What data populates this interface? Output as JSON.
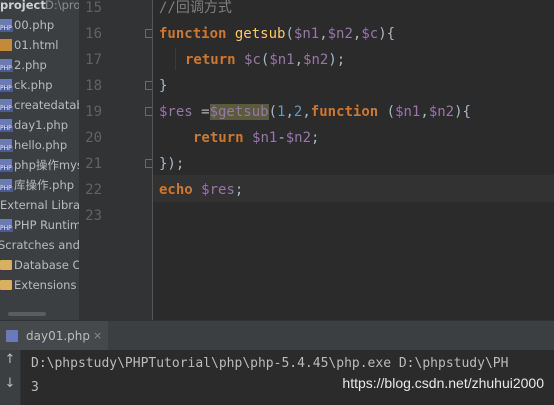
{
  "project": {
    "header_label": "project",
    "header_path": "D:\\proj",
    "items": [
      {
        "label": "00.php",
        "icon": "php-file-icon"
      },
      {
        "label": "01.html",
        "icon": "html-file-icon"
      },
      {
        "label": "2.php",
        "icon": "php-file-icon"
      },
      {
        "label": "ck.php",
        "icon": "php-file-icon"
      },
      {
        "label": "createdatab",
        "icon": "php-file-icon"
      },
      {
        "label": "day1.php",
        "icon": "php-file-icon"
      },
      {
        "label": "hello.php",
        "icon": "php-file-icon"
      },
      {
        "label": "php操作mys",
        "icon": "php-file-icon"
      },
      {
        "label": "库操作.php",
        "icon": "php-file-icon"
      },
      {
        "label": "External Librari",
        "icon": "library-icon"
      },
      {
        "label": "PHP Runtim",
        "icon": "php-runtime-icon"
      },
      {
        "label": "Scratches and C",
        "icon": "scratches-icon"
      },
      {
        "label": "Database C",
        "icon": "folder-icon"
      },
      {
        "label": "Extensions",
        "icon": "folder-icon"
      }
    ]
  },
  "editor": {
    "line_numbers": [
      "15",
      "16",
      "17",
      "18",
      "19",
      "20",
      "21",
      "22",
      "23"
    ],
    "current_line": "22",
    "lines": {
      "l15": {
        "comment": "//回调方式"
      },
      "l16": {
        "kw": "function",
        "name": "getsub",
        "open": "(",
        "p1": "$n1",
        "c1": ",",
        "p2": "$n2",
        "c2": ",",
        "p3": "$c",
        "close": "){"
      },
      "l17": {
        "kw": "return",
        "call": "$c",
        "open": "(",
        "p1": "$n1",
        "c1": ",",
        "p2": "$n2",
        "close": ");"
      },
      "l18": {
        "text": "}"
      },
      "l19": {
        "var": "$res",
        "eq": " =",
        "call": "$getsub",
        "open": "(",
        "n1": "1",
        "c1": ",",
        "n2": "2",
        "c2": ",",
        "kw": "function",
        "sp": " (",
        "p1": "$n1",
        "c3": ",",
        "p2": "$n2",
        "close": "){"
      },
      "l20": {
        "kw": "return",
        "p1": "$n1",
        "op": "-",
        "p2": "$n2",
        "end": ";"
      },
      "l21": {
        "text": "});"
      },
      "l22": {
        "kw": "echo",
        "var": "$res",
        "end": ";"
      }
    }
  },
  "run": {
    "tab_label": "day01.php",
    "tab_close": "×",
    "output": [
      "D:\\phpstudy\\PHPTutorial\\php\\php-5.4.45\\php.exe D:\\phpstudy\\PH",
      "3"
    ],
    "up_arrow": "↑",
    "down_arrow": "↓"
  },
  "watermark": "https://blog.csdn.net/zhuhui2000",
  "colors": {
    "keyword": "#cc7832",
    "function_name": "#ffc66d",
    "variable": "#9876aa",
    "number": "#6897bb",
    "comment": "#808080",
    "background": "#2b2b2b"
  }
}
